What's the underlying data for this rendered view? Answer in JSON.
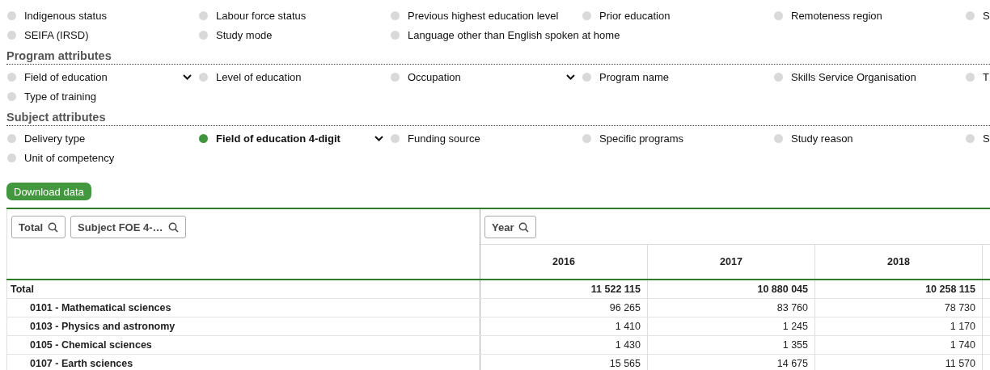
{
  "attribute_groups": [
    {
      "items": [
        {
          "label": "Indigenous status",
          "selected": false,
          "dropdown": false
        },
        {
          "label": "Labour force status",
          "selected": false,
          "dropdown": false
        },
        {
          "label": "Previous highest education level",
          "selected": false,
          "dropdown": false
        },
        {
          "label": "Prior education",
          "selected": false,
          "dropdown": false
        },
        {
          "label": "Remoteness region",
          "selected": false,
          "dropdown": false
        },
        {
          "label": "S",
          "selected": false,
          "dropdown": false
        },
        {
          "label": "SEIFA (IRSD)",
          "selected": false,
          "dropdown": false
        },
        {
          "label": "Study mode",
          "selected": false,
          "dropdown": false
        },
        {
          "label": "Language other than English spoken at home",
          "selected": false,
          "dropdown": false
        }
      ]
    },
    {
      "heading": "Program attributes",
      "items": [
        {
          "label": "Field of education",
          "selected": false,
          "dropdown": true
        },
        {
          "label": "Level of education",
          "selected": false,
          "dropdown": false
        },
        {
          "label": "Occupation",
          "selected": false,
          "dropdown": true
        },
        {
          "label": "Program name",
          "selected": false,
          "dropdown": false
        },
        {
          "label": "Skills Service Organisation",
          "selected": false,
          "dropdown": false
        },
        {
          "label": "T",
          "selected": false,
          "dropdown": false
        },
        {
          "label": "Type of training",
          "selected": false,
          "dropdown": false
        }
      ]
    },
    {
      "heading": "Subject attributes",
      "items": [
        {
          "label": "Delivery type",
          "selected": false,
          "dropdown": false
        },
        {
          "label": "Field of education 4-digit",
          "selected": true,
          "dropdown": true
        },
        {
          "label": "Funding source",
          "selected": false,
          "dropdown": false
        },
        {
          "label": "Specific programs",
          "selected": false,
          "dropdown": false
        },
        {
          "label": "Study reason",
          "selected": false,
          "dropdown": false
        },
        {
          "label": "S",
          "selected": false,
          "dropdown": false
        },
        {
          "label": "Unit of competency",
          "selected": false,
          "dropdown": false
        }
      ]
    }
  ],
  "download_button": "Download data",
  "table": {
    "row_filters": [
      "Total",
      "Subject FOE 4-…"
    ],
    "column_filters": [
      "Year"
    ],
    "columns": [
      "2016",
      "2017",
      "2018"
    ],
    "rows": [
      {
        "label": "Total",
        "values": [
          "11 522 115",
          "10 880 045",
          "10 258 115"
        ],
        "children": [
          {
            "label": "0101 - Mathematical sciences",
            "values": [
              "96 265",
              "83 760",
              "78 730"
            ]
          },
          {
            "label": "0103 - Physics and astronomy",
            "values": [
              "1 410",
              "1 245",
              "1 170"
            ]
          },
          {
            "label": "0105 - Chemical sciences",
            "values": [
              "1 430",
              "1 355",
              "1 740"
            ]
          },
          {
            "label": "0107 - Earth sciences",
            "values": [
              "15 565",
              "14 675",
              "11 570"
            ]
          }
        ]
      }
    ]
  }
}
